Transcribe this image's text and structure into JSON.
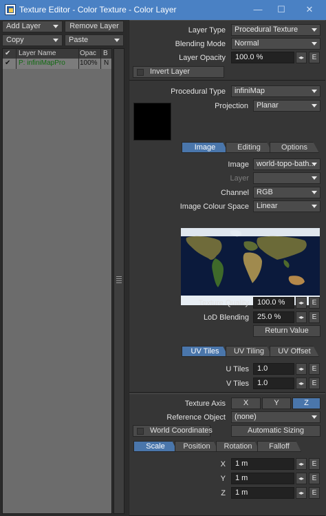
{
  "window": {
    "title": "Texture Editor - Color Texture - Color Layer",
    "minimize": "—",
    "maximize": "☐",
    "close": "✕"
  },
  "left_panel": {
    "add_layer": "Add Layer",
    "remove_layer": "Remove Layer",
    "copy": "Copy",
    "paste": "Paste",
    "columns": {
      "check": "✔",
      "name": "Layer Name",
      "opacity": "Opac",
      "blend": "B"
    },
    "layers": [
      {
        "check": "✔",
        "name": "P: infiniMapPro",
        "opacity": "100%",
        "blend": "N"
      }
    ]
  },
  "layer_settings": {
    "layer_type_label": "Layer Type",
    "layer_type_value": "Procedural Texture",
    "blending_mode_label": "Blending Mode",
    "blending_mode_value": "Normal",
    "layer_opacity_label": "Layer Opacity",
    "layer_opacity_value": "100.0 %",
    "invert_layer": "Invert Layer"
  },
  "procedural": {
    "type_label": "Procedural Type",
    "type_value": "infiniMap",
    "projection_label": "Projection",
    "projection_value": "Planar",
    "swatch_color": "#000000",
    "tabs": [
      "Image",
      "Editing",
      "Options"
    ],
    "active_tab": "Image",
    "image_label": "Image",
    "image_value": "world-topo-bath...",
    "layer_label": "Layer",
    "layer_value": "",
    "channel_label": "Channel",
    "channel_value": "RGB",
    "color_space_label": "Image Colour Space",
    "color_space_value": "Linear",
    "texture_quality_label": "Texture Quality",
    "texture_quality_value": "100.0 %",
    "lod_label": "LoD Blending",
    "lod_value": "25.0 %",
    "return_value": "Return Value",
    "uv_tabs": [
      "UV Tiles",
      "UV Tiling",
      "UV Offset"
    ],
    "u_tiles_label": "U Tiles",
    "u_tiles_value": "1.0",
    "v_tiles_label": "V Tiles",
    "v_tiles_value": "1.0"
  },
  "mapping": {
    "axis_label": "Texture Axis",
    "axes": [
      "X",
      "Y",
      "Z"
    ],
    "active_axis": "Z",
    "ref_object_label": "Reference Object",
    "ref_object_value": "(none)",
    "world_coords": "World Coordinates",
    "auto_sizing": "Automatic Sizing",
    "tabs": [
      "Scale",
      "Position",
      "Rotation",
      "Falloff"
    ],
    "x_label": "X",
    "x_value": "1 m",
    "y_label": "Y",
    "y_value": "1 m",
    "z_label": "Z",
    "z_value": "1 m"
  },
  "common": {
    "arrows": "◂▸",
    "envelope": "E"
  },
  "colors": {
    "titlebar": "#4a81c4",
    "accent_tab": "#4a76ab",
    "layer_name": "#116a11"
  }
}
